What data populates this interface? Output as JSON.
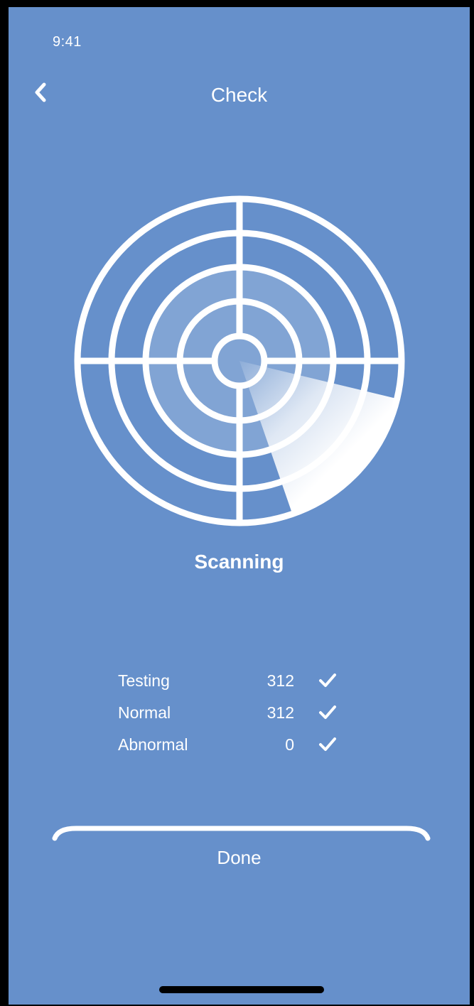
{
  "status_bar": {
    "time": "9:41"
  },
  "header": {
    "title": "Check",
    "back_icon": "chevron-left-icon"
  },
  "scan": {
    "status": "Scanning"
  },
  "stats": [
    {
      "label": "Testing",
      "value": "312",
      "icon": "checkmark-icon"
    },
    {
      "label": "Normal",
      "value": "312",
      "icon": "checkmark-icon"
    },
    {
      "label": "Abnormal",
      "value": "0",
      "icon": "checkmark-icon"
    }
  ],
  "footer": {
    "done_label": "Done"
  },
  "colors": {
    "background": "#6690CB",
    "foreground": "#FFFFFF"
  }
}
